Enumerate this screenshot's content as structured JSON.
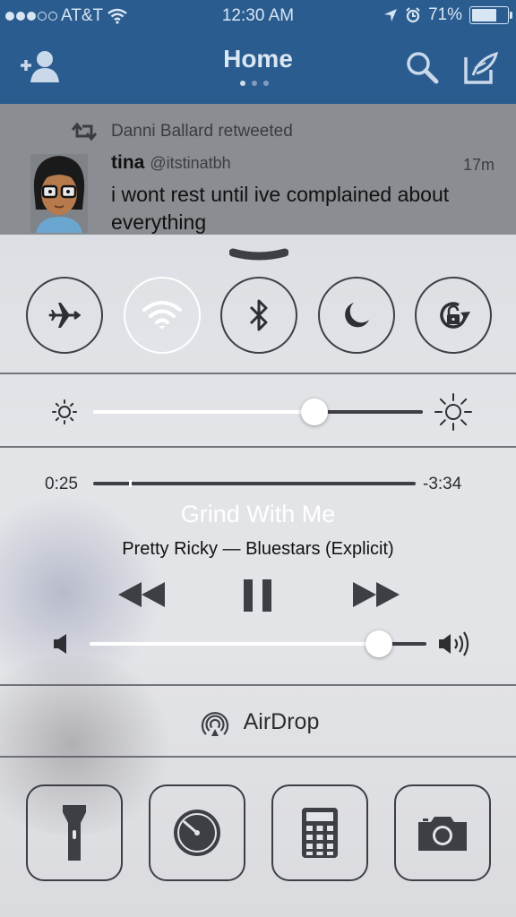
{
  "status_bar": {
    "carrier": "AT&T",
    "time": "12:30 AM",
    "battery": "71%",
    "battery_level": 0.71,
    "signal_bars": 3
  },
  "twitter": {
    "title": "Home",
    "pager_pages": 3,
    "pager_active": 0,
    "tweet": {
      "retweeted_by": "Danni Ballard retweeted",
      "name": "tina",
      "handle": "@itstinatbh",
      "time": "17m",
      "text": "i wont rest until ive complained about everything"
    }
  },
  "control_center": {
    "toggles": [
      {
        "name": "airplane-mode",
        "icon": "airplane-icon",
        "on": false
      },
      {
        "name": "wifi",
        "icon": "wifi-icon",
        "on": true
      },
      {
        "name": "bluetooth",
        "icon": "bluetooth-icon",
        "on": false
      },
      {
        "name": "do-not-disturb",
        "icon": "moon-icon",
        "on": false
      },
      {
        "name": "rotation-lock",
        "icon": "rotation-lock-icon",
        "on": false
      }
    ],
    "brightness": 0.67,
    "music": {
      "elapsed": "0:25",
      "remaining": "-3:34",
      "progress": 0.11,
      "song": "Grind With Me",
      "artist_album": "Pretty Ricky — Bluestars (Explicit)",
      "volume": 0.86
    },
    "airdrop_label": "AirDrop",
    "tools": [
      {
        "name": "flashlight",
        "icon": "flashlight-icon"
      },
      {
        "name": "timer",
        "icon": "timer-icon"
      },
      {
        "name": "calculator",
        "icon": "calculator-icon"
      },
      {
        "name": "camera",
        "icon": "camera-icon"
      }
    ]
  },
  "colors": {
    "twitter_blue": "#2a5c8f",
    "cc_background": "#e2e4e8",
    "control_stroke": "#3d3f44"
  }
}
